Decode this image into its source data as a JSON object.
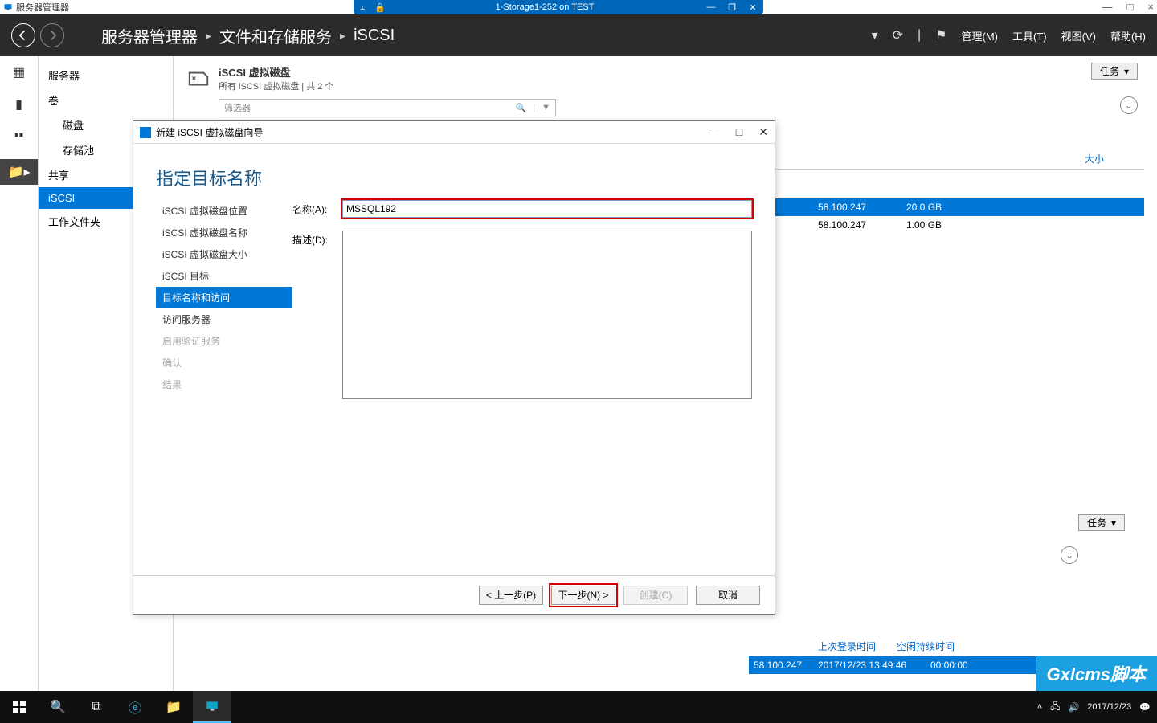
{
  "outer_title": "服务器管理器",
  "outer_controls": {
    "min": "—",
    "max": "□",
    "close": "×"
  },
  "rds": {
    "title": "1-Storage1-252 on TEST"
  },
  "header": {
    "breadcrumb": [
      "服务器管理器",
      "文件和存储服务",
      "iSCSI"
    ],
    "menus": [
      "管理(M)",
      "工具(T)",
      "视图(V)",
      "帮助(H)"
    ]
  },
  "nav": {
    "items": [
      {
        "label": "服务器",
        "lvl": 1
      },
      {
        "label": "卷",
        "lvl": 1
      },
      {
        "label": "磁盘",
        "lvl": 2
      },
      {
        "label": "存储池",
        "lvl": 2
      },
      {
        "label": "共享",
        "lvl": 1
      },
      {
        "label": "iSCSI",
        "lvl": 1,
        "selected": true
      },
      {
        "label": "工作文件夹",
        "lvl": 1
      }
    ]
  },
  "panel": {
    "title": "iSCSI 虚拟磁盘",
    "subtitle": "所有 iSCSI 虚拟磁盘 | 共 2 个",
    "tasks_label": "任务",
    "filter_placeholder": "筛选器",
    "col_size": "大小",
    "rows": [
      {
        "ip": "58.100.247",
        "size": "20.0 GB",
        "selected": true
      },
      {
        "ip": "58.100.247",
        "size": "1.00 GB"
      }
    ]
  },
  "panel2": {
    "tasks_label": "任务",
    "cols": [
      "上次登录时间",
      "空闲持续时间"
    ],
    "row": {
      "ip": "58.100.247",
      "time": "2017/12/23 13:49:46",
      "idle": "00:00:00"
    }
  },
  "wizard": {
    "title": "新建 iSCSI 虚拟磁盘向导",
    "heading": "指定目标名称",
    "steps": [
      {
        "label": "iSCSI 虚拟磁盘位置"
      },
      {
        "label": "iSCSI 虚拟磁盘名称"
      },
      {
        "label": "iSCSI 虚拟磁盘大小"
      },
      {
        "label": "iSCSI 目标"
      },
      {
        "label": "目标名称和访问",
        "current": true
      },
      {
        "label": "访问服务器"
      },
      {
        "label": "启用验证服务",
        "disabled": true
      },
      {
        "label": "确认",
        "disabled": true
      },
      {
        "label": "结果",
        "disabled": true
      }
    ],
    "name_label": "名称(A):",
    "name_value": "MSSQL192",
    "desc_label": "描述(D):",
    "buttons": {
      "prev": "< 上一步(P)",
      "next": "下一步(N) >",
      "create": "创建(C)",
      "cancel": "取消"
    }
  },
  "taskbar": {
    "time": "2017/12/23"
  },
  "watermark": "Gxlcms脚本"
}
